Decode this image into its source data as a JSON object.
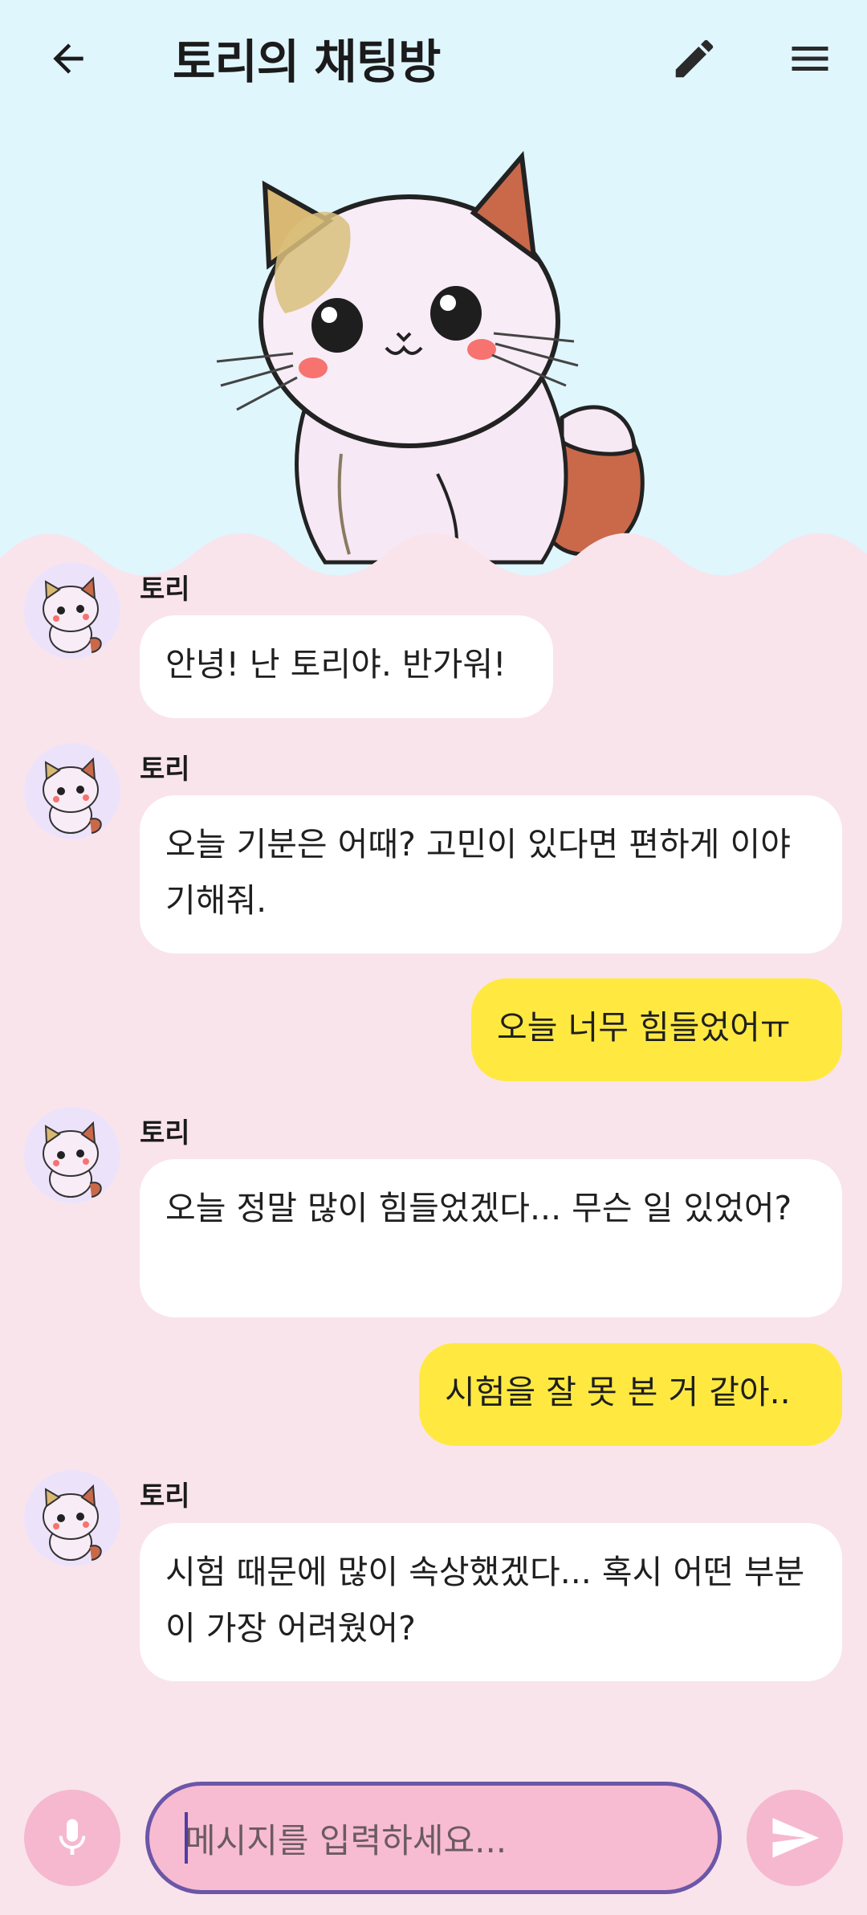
{
  "header": {
    "title": "토리의 채팅방",
    "back_icon": "arrow-left-icon",
    "edit_icon": "pencil-icon",
    "menu_icon": "hamburger-menu-icon"
  },
  "messages": [
    {
      "from": "bot",
      "sender": "토리",
      "text": "안녕! 난 토리야. 반가워!"
    },
    {
      "from": "bot",
      "sender": "토리",
      "text": "오늘 기분은 어때? 고민이 있다면 편하게 이야기해줘."
    },
    {
      "from": "user",
      "text": "오늘 너무 힘들었어ㅠ"
    },
    {
      "from": "bot",
      "sender": "토리",
      "text": "오늘 정말 많이 힘들었겠다... 무슨 일 있었어?"
    },
    {
      "from": "user",
      "text": "시험을 잘 못 본 거 같아.."
    },
    {
      "from": "bot",
      "sender": "토리",
      "text": "시험 때문에 많이 속상했겠다... 혹시 어떤 부분이 가장 어려웠어?"
    }
  ],
  "composer": {
    "placeholder": "메시지를 입력하세요...",
    "mic_icon": "microphone-icon",
    "send_icon": "send-icon"
  },
  "colors": {
    "header_bg": "#dff6fd",
    "chat_bg": "#f9e4ec",
    "user_bubble": "#ffe941",
    "bot_bubble": "#ffffff",
    "input_border": "#6b56a8"
  }
}
